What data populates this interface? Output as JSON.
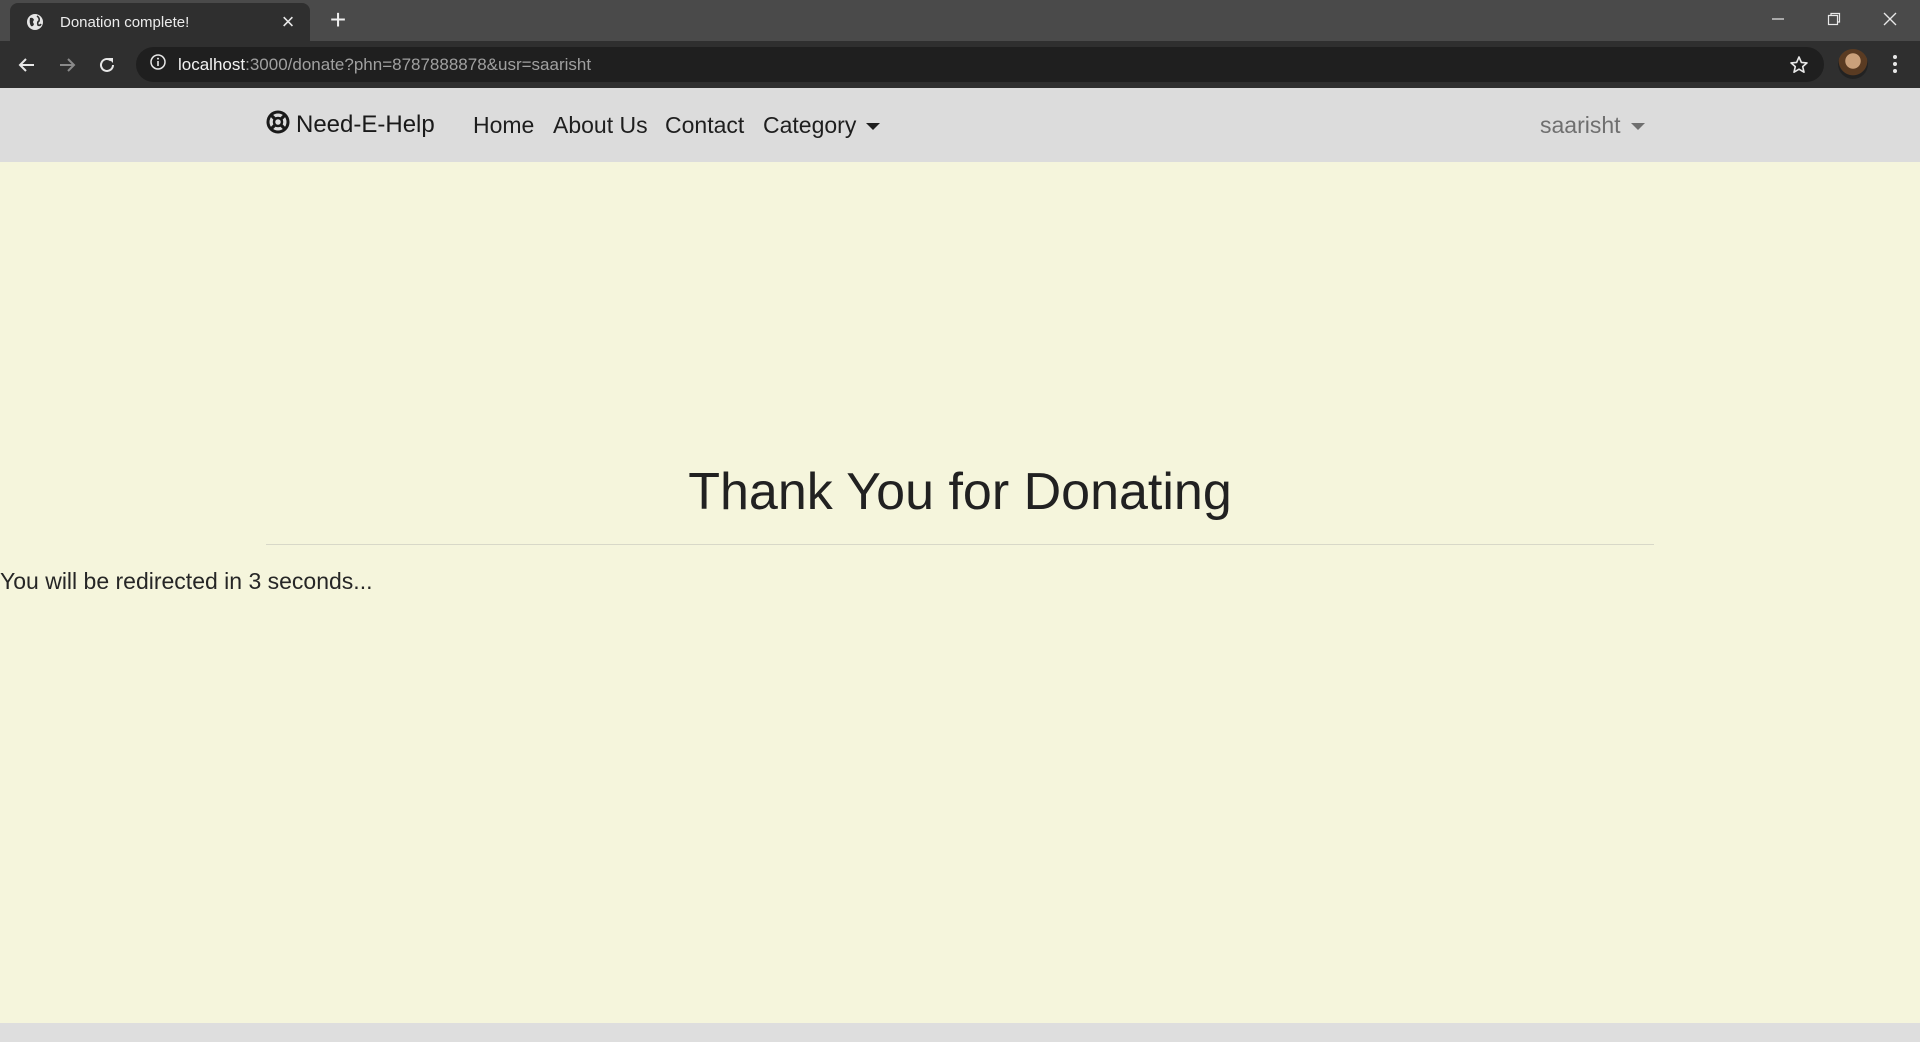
{
  "browser": {
    "tab_title": "Donation complete!",
    "url_host": "localhost",
    "url_path": ":3000/donate?phn=8787888878&usr=saarisht",
    "icons": [
      "globe-icon",
      "close-icon",
      "plus-icon",
      "minimize-icon",
      "restore-icon",
      "close-window-icon",
      "back-arrow-icon",
      "forward-arrow-icon",
      "reload-icon",
      "info-icon",
      "star-icon",
      "avatar",
      "kebab-menu-icon"
    ]
  },
  "navbar": {
    "brand": "Need-E-Help",
    "brand_icon": "lifebuoy-icon",
    "links": [
      "Home",
      "About Us",
      "Contact",
      "Category"
    ],
    "user": "saarisht"
  },
  "main": {
    "heading": "Thank You for Donating",
    "redirect_message": "You will be redirected in 3 seconds..."
  },
  "colors": {
    "page_background": "#f5f5dc",
    "navbar_background": "#dcdcdc",
    "browser_frame": "#4a4a4a"
  }
}
